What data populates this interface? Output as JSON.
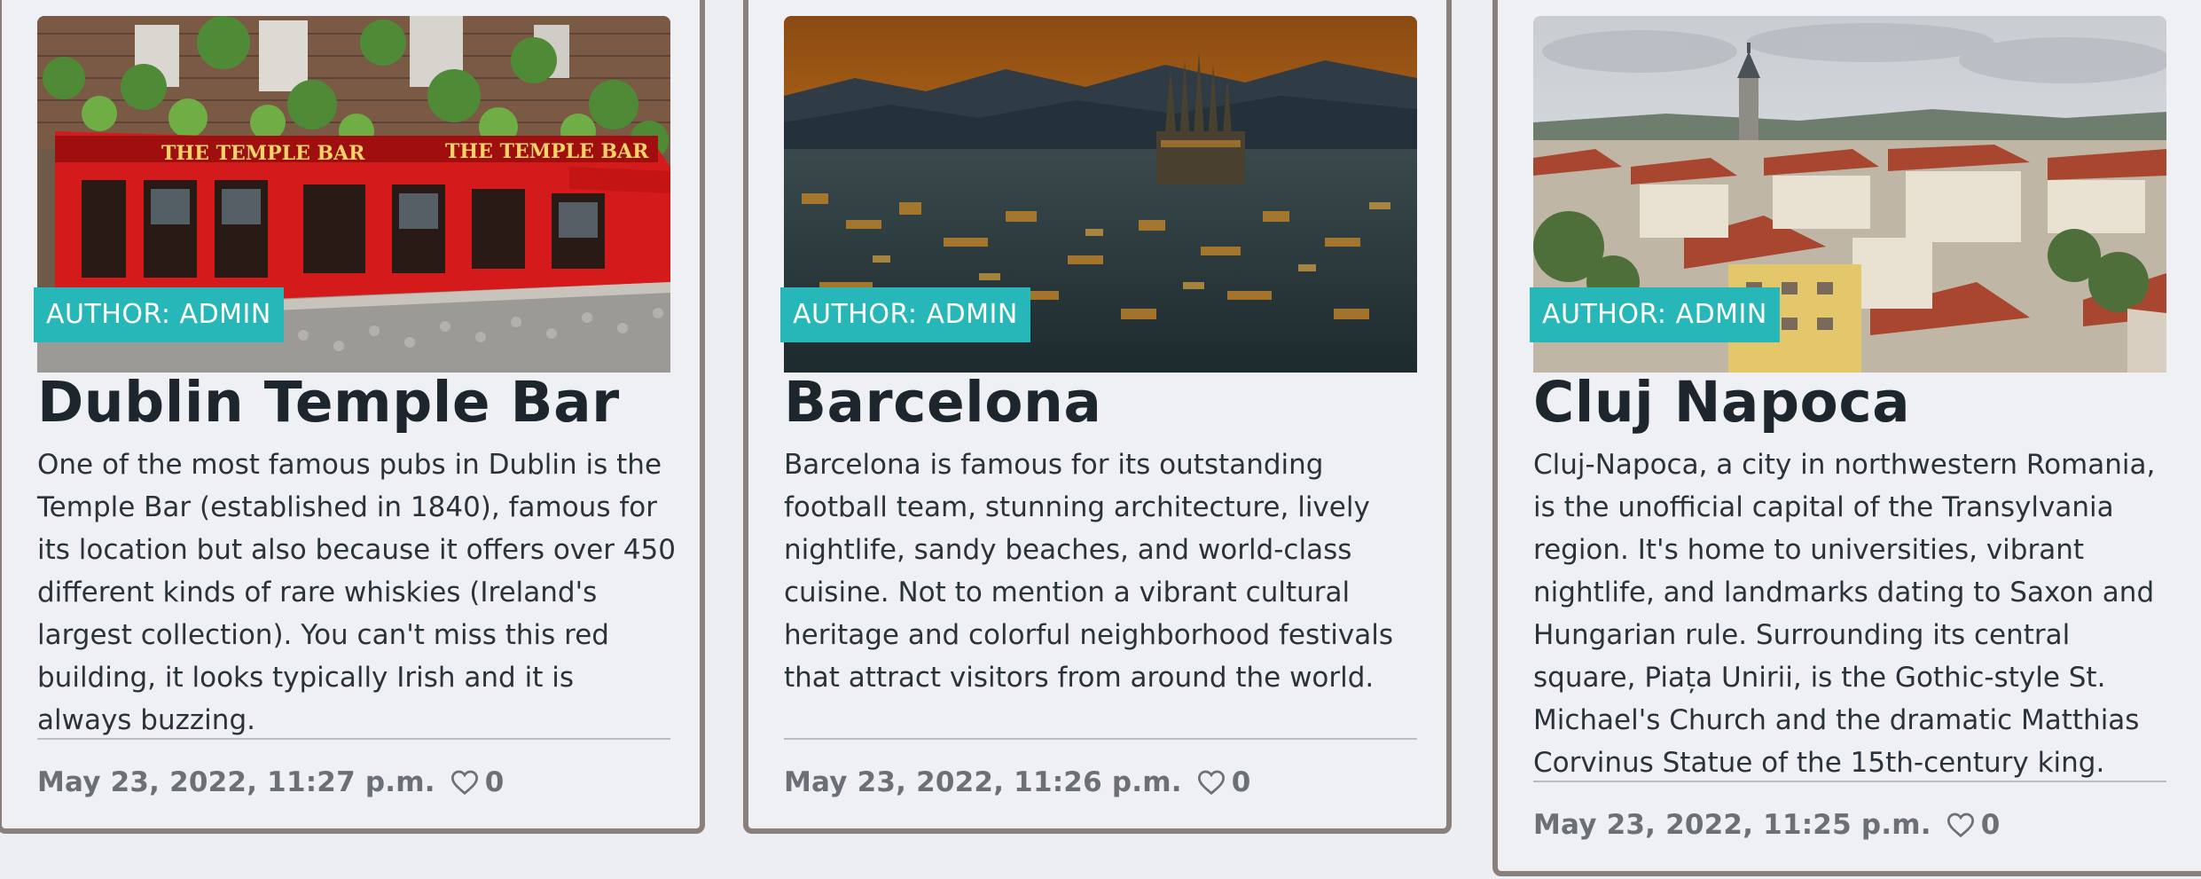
{
  "posts": [
    {
      "author_badge": "AUTHOR: ADMIN",
      "title": "Dublin Temple Bar",
      "excerpt": "One of the most famous pubs in Dublin is the Temple Bar (established in 1840), famous for its location but also because it offers over 450 different kinds of rare whiskies (Ireland's largest collection). You can't miss this red building, it looks typically Irish and it is always buzzing.",
      "date": "May 23, 2022, 11:27 p.m.",
      "likes": "0",
      "image_sign": "THE TEMPLE BAR"
    },
    {
      "author_badge": "AUTHOR: ADMIN",
      "title": "Barcelona",
      "excerpt": "Barcelona is famous for its outstanding football team, stunning architecture, lively nightlife, sandy beaches, and world-class cuisine. Not to mention a vibrant cultural heritage and colorful neighborhood festivals that attract visitors from around the world.",
      "date": "May 23, 2022, 11:26 p.m.",
      "likes": "0"
    },
    {
      "author_badge": "AUTHOR: ADMIN",
      "title": "Cluj Napoca",
      "excerpt": "Cluj-Napoca, a city in northwestern Romania, is the unofficial capital of the Transylvania region. It's home to universities, vibrant nightlife, and landmarks dating to Saxon and Hungarian rule. Surrounding its central square, Piața Unirii, is the Gothic-style St. Michael's Church and the dramatic Matthias Corvinus Statue of the 15th-century king.",
      "date": "May 23, 2022, 11:25 p.m.",
      "likes": "0"
    }
  ],
  "colors": {
    "badge": "#27b7b8",
    "card_border": "#8a807b",
    "page_background": "#eceef1",
    "title_text": "#1d262d",
    "meta_text": "#6b7076"
  },
  "icons": {
    "like": "heart-outline-icon"
  }
}
